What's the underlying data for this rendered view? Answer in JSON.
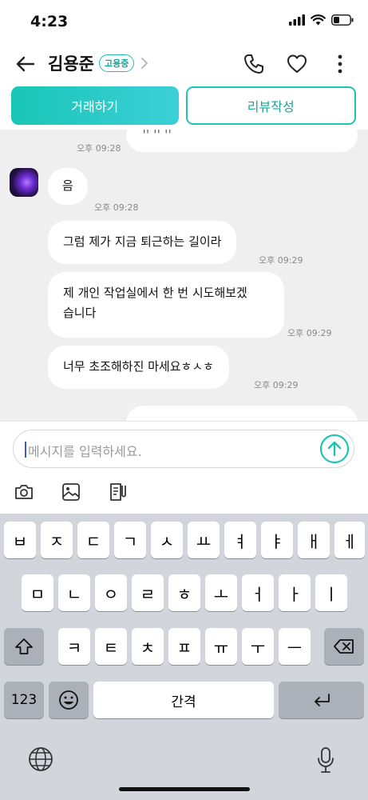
{
  "status": {
    "time": "4:23"
  },
  "header": {
    "contact_name": "김용준",
    "badge": "고용중"
  },
  "actions": {
    "trade": "거래하기",
    "review": "리뷰작성"
  },
  "messages": [
    {
      "text": "ㅠㅠㅠ",
      "time": "오후 09:28"
    },
    {
      "text": "음",
      "time": "오후 09:28"
    },
    {
      "text": "그럼 제가 지금 퇴근하는 길이라",
      "time": "오후 09:29"
    },
    {
      "line1": "제 개인 작업실에서 한 번 시도해보겠",
      "line2": "습니다",
      "time": "오후 09:29"
    },
    {
      "text": "너무 초조해하진 마세요ㅎㅅㅎ",
      "time": "오후 09:29"
    }
  ],
  "input": {
    "placeholder": "메시지를 입력하세요."
  },
  "keyboard": {
    "row1": [
      "ㅂ",
      "ㅈ",
      "ㄷ",
      "ㄱ",
      "ㅅ",
      "ㅛ",
      "ㅕ",
      "ㅑ",
      "ㅐ",
      "ㅔ"
    ],
    "row2": [
      "ㅁ",
      "ㄴ",
      "ㅇ",
      "ㄹ",
      "ㅎ",
      "ㅗ",
      "ㅓ",
      "ㅏ",
      "ㅣ"
    ],
    "row3": [
      "ㅋ",
      "ㅌ",
      "ㅊ",
      "ㅍ",
      "ㅠ",
      "ㅜ",
      "ㅡ"
    ],
    "numbers": "123",
    "space": "간격"
  },
  "colors": {
    "accent": "#1fc3b3",
    "chat_bg": "#efeff0",
    "keyboard_bg": "#d2d5db"
  }
}
